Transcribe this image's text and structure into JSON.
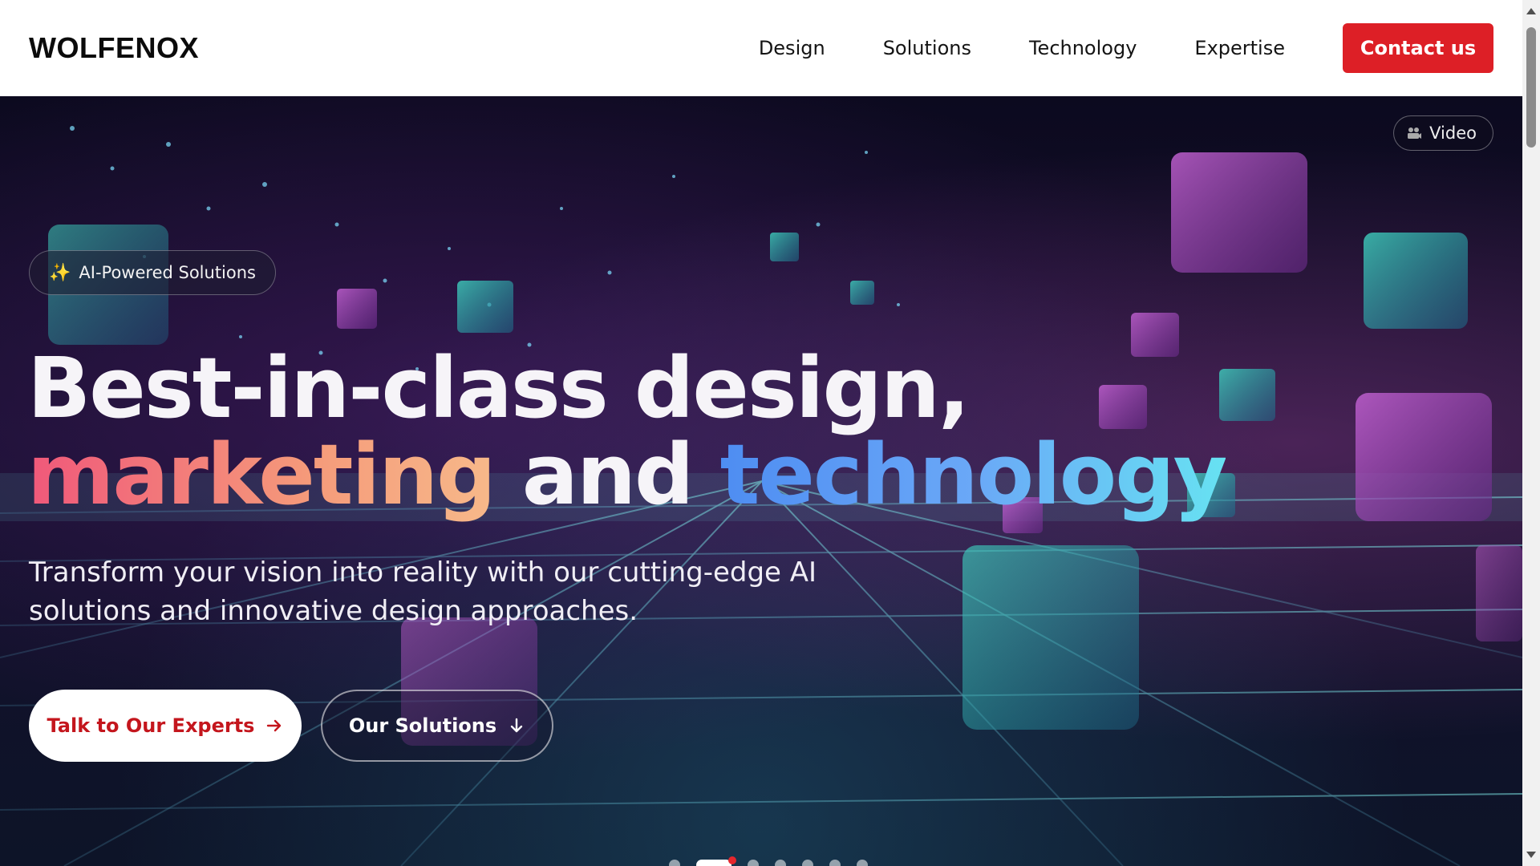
{
  "header": {
    "logo": "WOLFENOX",
    "nav": [
      {
        "label": "Design"
      },
      {
        "label": "Solutions"
      },
      {
        "label": "Technology"
      },
      {
        "label": "Expertise"
      }
    ],
    "contact_label": "Contact us"
  },
  "hero": {
    "video_label": "Video",
    "badge_label": "AI-Powered Solutions",
    "headline_line1": "Best-in-class design,",
    "headline_word_warm": "marketing",
    "headline_word_and": " and ",
    "headline_word_cool": "technology",
    "subtitle": "Transform your vision into reality with our cutting-edge AI solutions and innovative design approaches.",
    "primary_cta": "Talk to Our Experts",
    "secondary_cta": "Our Solutions",
    "carousel": {
      "count": 7,
      "active_index": 1
    }
  },
  "colors": {
    "brand_red": "#dd1f26",
    "warm_gradient": [
      "#f0587a",
      "#f7b98a"
    ],
    "cool_gradient": [
      "#4e8df2",
      "#67e2f2"
    ]
  }
}
